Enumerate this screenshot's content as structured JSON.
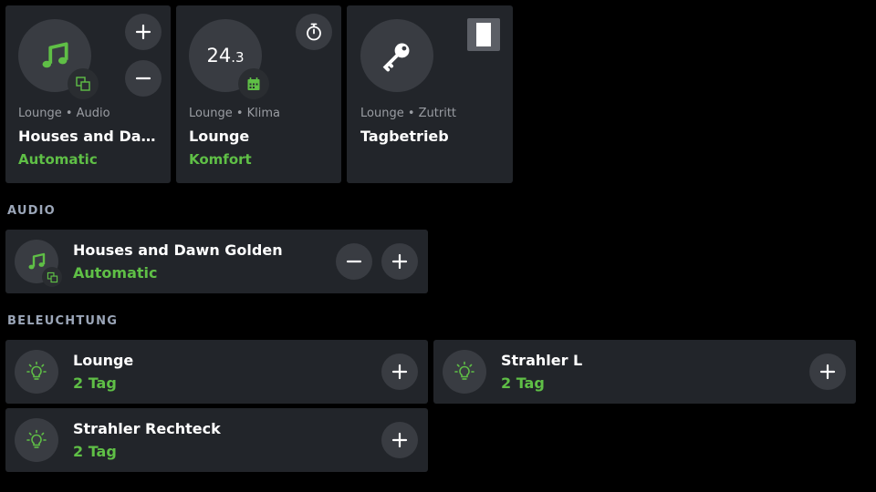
{
  "colors": {
    "accent": "#5fbf46",
    "tile_bg": "#22252a",
    "circle_bg": "#393c42",
    "section_label": "#9ba6b8"
  },
  "tiles": [
    {
      "icon": "music-note-icon",
      "badge_icon": "group-icon",
      "subtitle": "Lounge • Audio",
      "title": "Houses and Daw…",
      "status": "Automatic"
    },
    {
      "temperature": "24",
      "temperature_decimal": ".3",
      "badge_icon": "calendar-icon",
      "action_icon": "timer-icon",
      "subtitle": "Lounge • Klima",
      "title": "Lounge",
      "status": "Komfort"
    },
    {
      "icon": "key-icon",
      "action_icon": "door-icon",
      "subtitle": "Lounge • Zutritt",
      "title": "Tagbetrieb"
    }
  ],
  "sections": {
    "audio": {
      "label": "AUDIO",
      "items": [
        {
          "icon": "music-note-icon",
          "title": "Houses and Dawn Golden",
          "status": "Automatic"
        }
      ]
    },
    "lighting": {
      "label": "BELEUCHTUNG",
      "items": [
        {
          "icon": "lightbulb-icon",
          "title": "Lounge",
          "status": "2 Tag"
        },
        {
          "icon": "lightbulb-icon",
          "title": "Strahler L",
          "status": "2 Tag"
        },
        {
          "icon": "lightbulb-icon",
          "title": "Strahler Rechteck",
          "status": "2 Tag"
        }
      ]
    }
  }
}
